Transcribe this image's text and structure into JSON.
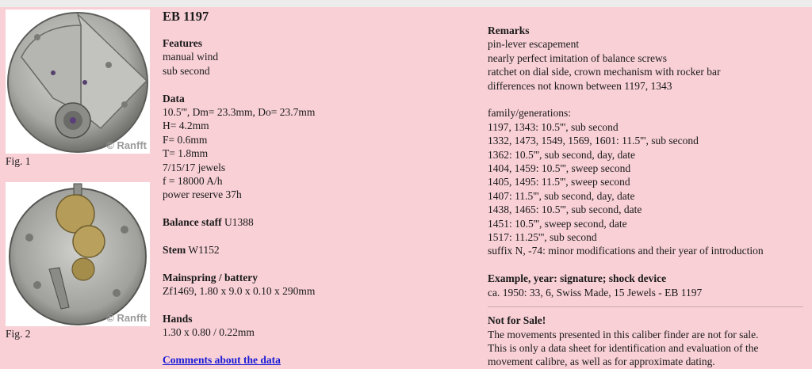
{
  "figures": [
    {
      "caption": "Fig. 1",
      "watermark": "© Ranfft"
    },
    {
      "caption": "Fig. 2",
      "watermark": "© Ranfft"
    }
  ],
  "caliber": {
    "title": "EB 1197",
    "features_heading": "Features",
    "features": [
      "manual wind",
      "sub second"
    ],
    "data_heading": "Data",
    "data": [
      "10.5''', Dm= 23.3mm, Do= 23.7mm",
      "H= 4.2mm",
      "F= 0.6mm",
      "T= 1.8mm",
      "7/15/17 jewels",
      "f = 18000 A/h",
      "power reserve 37h"
    ],
    "balance_staff_label": "Balance staff",
    "balance_staff_value": " U1388",
    "stem_label": "Stem",
    "stem_value": " W1152",
    "mainspring_heading": "Mainspring / battery",
    "mainspring_value": "Zf1469, 1.80 x 9.0 x 0.10 x 290mm",
    "hands_heading": "Hands",
    "hands_value": "1.30 x 0.80 / 0.22mm",
    "comments_link": "Comments about the data"
  },
  "remarks": {
    "heading": "Remarks",
    "lines": [
      "pin-lever escapement",
      "nearly perfect imitation of balance screws",
      "ratchet on dial side, crown mechanism with rocker bar",
      "differences not known between 1197, 1343"
    ],
    "family_heading": "family/generations:",
    "family": [
      "1197, 1343: 10.5''', sub second",
      "1332, 1473, 1549, 1569, 1601: 11.5''', sub second",
      "1362: 10.5''', sub second, day, date",
      "1404, 1459: 10.5''', sweep second",
      "1405, 1495: 11.5''', sweep second",
      "1407: 11.5''', sub second, day, date",
      "1438, 1465: 10.5''', sub second, date",
      "1451: 10.5''', sweep second, date",
      "1517: 11.25''', sub second",
      "suffix N, -74: minor modifications and their year of introduction"
    ],
    "example_heading": "Example, year: signature; shock device",
    "example_value": "ca. 1950: 33, 6, Swiss Made, 15 Jewels - EB 1197",
    "notsale_heading": "Not for Sale!",
    "notsale_lines": [
      "The movements presented in this caliber finder are not for sale.",
      "This is only a data sheet for identification and evaluation of the",
      "movement calibre, as well as for approximate dating."
    ]
  }
}
